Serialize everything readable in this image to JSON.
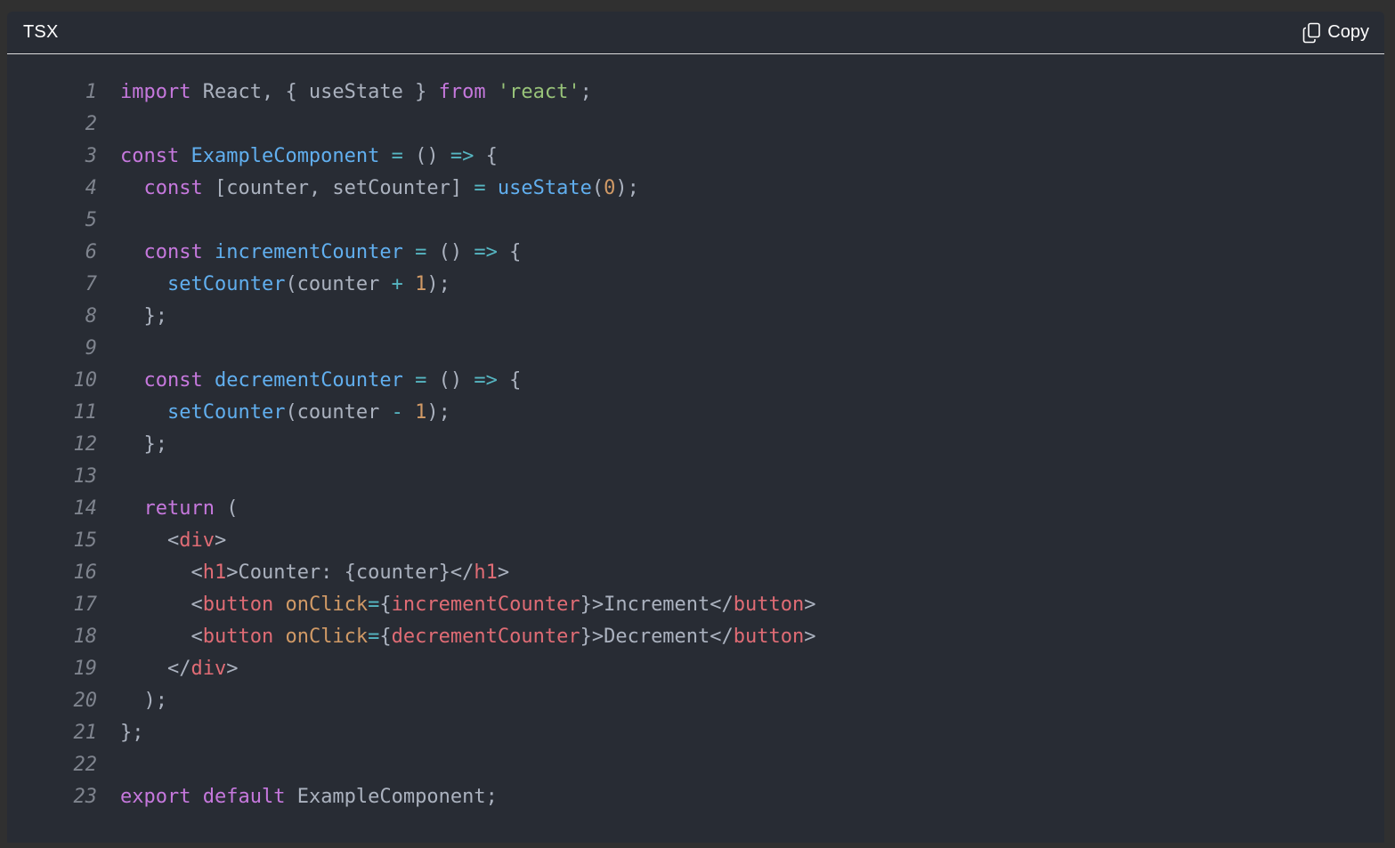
{
  "header": {
    "language": "TSX",
    "copy_label": "Copy"
  },
  "colors": {
    "background": "#282c34",
    "keyword": "#c678dd",
    "function": "#61afef",
    "string": "#98c379",
    "number": "#d19a66",
    "operator": "#56b6c2",
    "tag": "#e06c75",
    "plain": "#abb2bf",
    "line_number": "#7f848e"
  },
  "code": {
    "lines": [
      {
        "n": "1",
        "tokens": [
          [
            "kw",
            "import"
          ],
          [
            "plain",
            " React, { useState } "
          ],
          [
            "kw",
            "from"
          ],
          [
            "plain",
            " "
          ],
          [
            "str",
            "'react'"
          ],
          [
            "plain",
            ";"
          ]
        ]
      },
      {
        "n": "2",
        "tokens": []
      },
      {
        "n": "3",
        "tokens": [
          [
            "kw",
            "const"
          ],
          [
            "plain",
            " "
          ],
          [
            "fn",
            "ExampleComponent"
          ],
          [
            "plain",
            " "
          ],
          [
            "op",
            "="
          ],
          [
            "plain",
            " () "
          ],
          [
            "op",
            "=>"
          ],
          [
            "plain",
            " {"
          ]
        ]
      },
      {
        "n": "4",
        "tokens": [
          [
            "plain",
            "  "
          ],
          [
            "kw",
            "const"
          ],
          [
            "plain",
            " [counter, setCounter] "
          ],
          [
            "op",
            "="
          ],
          [
            "plain",
            " "
          ],
          [
            "fn",
            "useState"
          ],
          [
            "plain",
            "("
          ],
          [
            "num",
            "0"
          ],
          [
            "plain",
            ");"
          ]
        ]
      },
      {
        "n": "5",
        "tokens": []
      },
      {
        "n": "6",
        "tokens": [
          [
            "plain",
            "  "
          ],
          [
            "kw",
            "const"
          ],
          [
            "plain",
            " "
          ],
          [
            "fn",
            "incrementCounter"
          ],
          [
            "plain",
            " "
          ],
          [
            "op",
            "="
          ],
          [
            "plain",
            " () "
          ],
          [
            "op",
            "=>"
          ],
          [
            "plain",
            " {"
          ]
        ]
      },
      {
        "n": "7",
        "tokens": [
          [
            "plain",
            "    "
          ],
          [
            "fn",
            "setCounter"
          ],
          [
            "plain",
            "(counter "
          ],
          [
            "op",
            "+"
          ],
          [
            "plain",
            " "
          ],
          [
            "num",
            "1"
          ],
          [
            "plain",
            ");"
          ]
        ]
      },
      {
        "n": "8",
        "tokens": [
          [
            "plain",
            "  };"
          ]
        ]
      },
      {
        "n": "9",
        "tokens": []
      },
      {
        "n": "10",
        "tokens": [
          [
            "plain",
            "  "
          ],
          [
            "kw",
            "const"
          ],
          [
            "plain",
            " "
          ],
          [
            "fn",
            "decrementCounter"
          ],
          [
            "plain",
            " "
          ],
          [
            "op",
            "="
          ],
          [
            "plain",
            " () "
          ],
          [
            "op",
            "=>"
          ],
          [
            "plain",
            " {"
          ]
        ]
      },
      {
        "n": "11",
        "tokens": [
          [
            "plain",
            "    "
          ],
          [
            "fn",
            "setCounter"
          ],
          [
            "plain",
            "(counter "
          ],
          [
            "op",
            "-"
          ],
          [
            "plain",
            " "
          ],
          [
            "num",
            "1"
          ],
          [
            "plain",
            ");"
          ]
        ]
      },
      {
        "n": "12",
        "tokens": [
          [
            "plain",
            "  };"
          ]
        ]
      },
      {
        "n": "13",
        "tokens": []
      },
      {
        "n": "14",
        "tokens": [
          [
            "plain",
            "  "
          ],
          [
            "kw",
            "return"
          ],
          [
            "plain",
            " ("
          ]
        ]
      },
      {
        "n": "15",
        "tokens": [
          [
            "plain",
            "    <"
          ],
          [
            "tag",
            "div"
          ],
          [
            "plain",
            ">"
          ]
        ]
      },
      {
        "n": "16",
        "tokens": [
          [
            "plain",
            "      <"
          ],
          [
            "tag",
            "h1"
          ],
          [
            "plain",
            ">Counter: {counter}</"
          ],
          [
            "tag",
            "h1"
          ],
          [
            "plain",
            ">"
          ]
        ]
      },
      {
        "n": "17",
        "tokens": [
          [
            "plain",
            "      <"
          ],
          [
            "tag",
            "button"
          ],
          [
            "plain",
            " "
          ],
          [
            "attr",
            "onClick"
          ],
          [
            "op",
            "="
          ],
          [
            "plain",
            "{"
          ],
          [
            "tag",
            "incrementCounter"
          ],
          [
            "plain",
            "}>Increment</"
          ],
          [
            "tag",
            "button"
          ],
          [
            "plain",
            ">"
          ]
        ]
      },
      {
        "n": "18",
        "tokens": [
          [
            "plain",
            "      <"
          ],
          [
            "tag",
            "button"
          ],
          [
            "plain",
            " "
          ],
          [
            "attr",
            "onClick"
          ],
          [
            "op",
            "="
          ],
          [
            "plain",
            "{"
          ],
          [
            "tag",
            "decrementCounter"
          ],
          [
            "plain",
            "}>Decrement</"
          ],
          [
            "tag",
            "button"
          ],
          [
            "plain",
            ">"
          ]
        ]
      },
      {
        "n": "19",
        "tokens": [
          [
            "plain",
            "    </"
          ],
          [
            "tag",
            "div"
          ],
          [
            "plain",
            ">"
          ]
        ]
      },
      {
        "n": "20",
        "tokens": [
          [
            "plain",
            "  );"
          ]
        ]
      },
      {
        "n": "21",
        "tokens": [
          [
            "plain",
            "};"
          ]
        ]
      },
      {
        "n": "22",
        "tokens": []
      },
      {
        "n": "23",
        "tokens": [
          [
            "kw",
            "export"
          ],
          [
            "plain",
            " "
          ],
          [
            "kw",
            "default"
          ],
          [
            "plain",
            " ExampleComponent;"
          ]
        ]
      }
    ]
  }
}
